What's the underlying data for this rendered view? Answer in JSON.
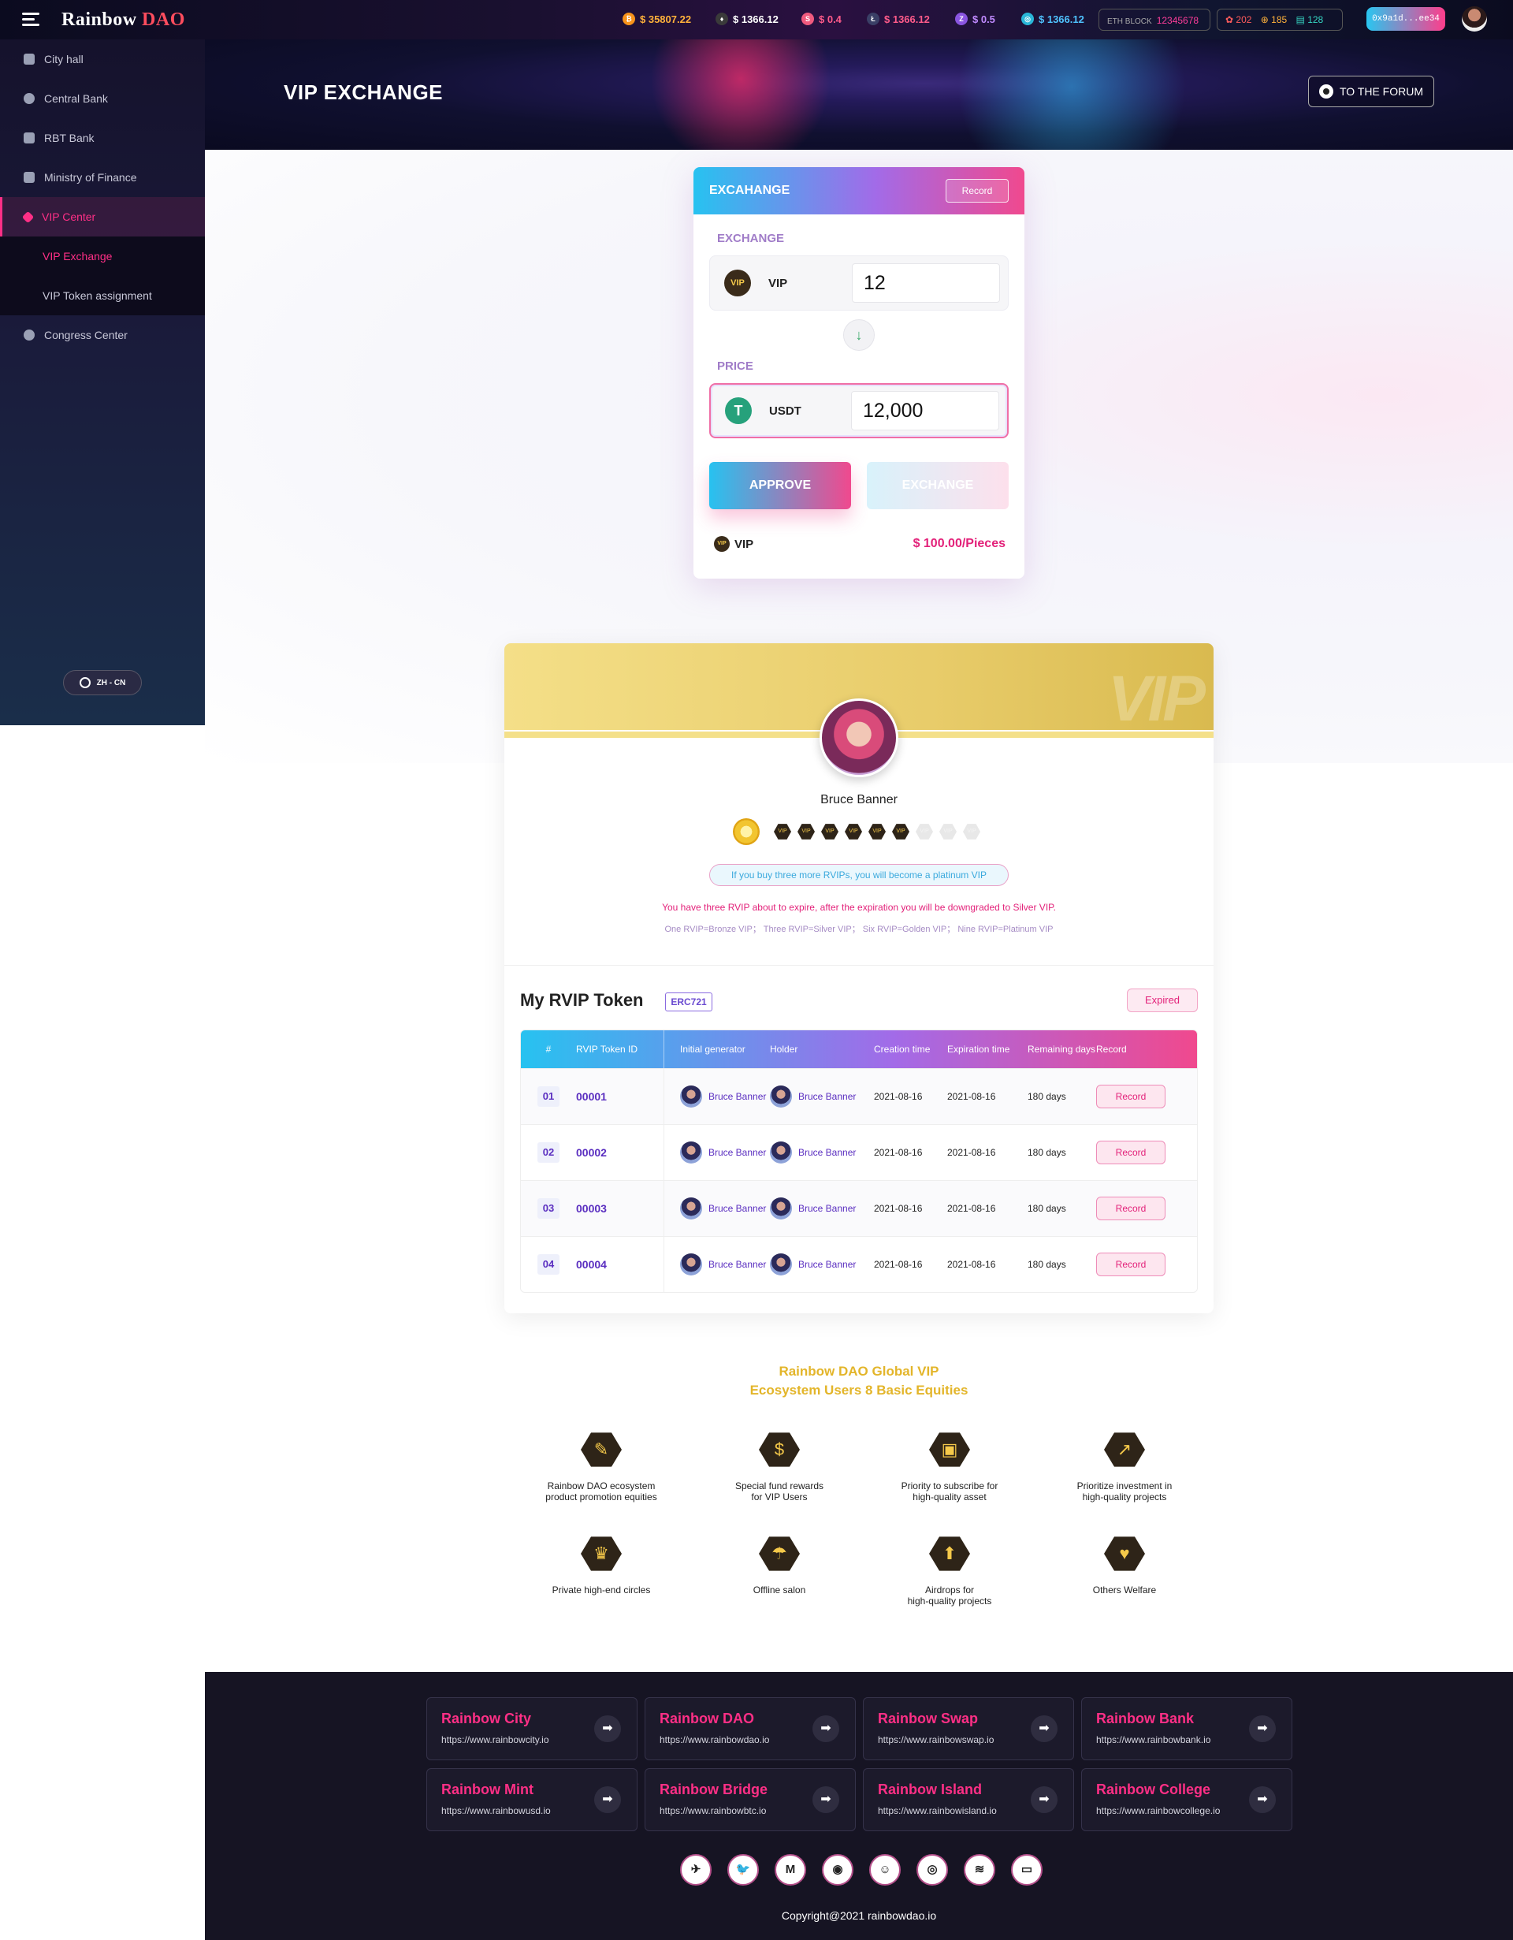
{
  "app": {
    "logo_main": "Rainbow ",
    "logo_accent": "DAO"
  },
  "topbar": {
    "prices": [
      {
        "icon": "bitcoin-icon",
        "symbol": "₿",
        "color": "#f7931a",
        "text_color": "#ffb23b",
        "value": "$ 35807.22"
      },
      {
        "icon": "ethereum-icon",
        "symbol": "♦",
        "color": "#3a3a3a",
        "text_color": "#ffffff",
        "value": "$ 1366.12"
      },
      {
        "icon": "sushi-icon",
        "symbol": "S",
        "color": "#f05a7e",
        "text_color": "#ff5b8a",
        "value": "$ 0.4"
      },
      {
        "icon": "litecoin-icon",
        "symbol": "Ł",
        "color": "#3a3f66",
        "text_color": "#ff5b8a",
        "value": "$ 1366.12"
      },
      {
        "icon": "zcash-icon",
        "symbol": "Z",
        "color": "#8a55e0",
        "text_color": "#c08aff",
        "value": "$ 0.5"
      },
      {
        "icon": "token-icon",
        "symbol": "◎",
        "color": "#2ab6d8",
        "text_color": "#4fc3ff",
        "value": "$ 1366.12"
      }
    ],
    "eth_block_label": "ETH BLOCK",
    "eth_block_value": "12345678",
    "stats": [
      "202",
      "185",
      "128"
    ],
    "wallet": "0x9a1d...ee34"
  },
  "sidebar": {
    "items": [
      {
        "label": "City hall"
      },
      {
        "label": "Central Bank"
      },
      {
        "label": "RBT Bank"
      },
      {
        "label": "Ministry of Finance"
      },
      {
        "label": "VIP Center"
      }
    ],
    "sub_items": [
      {
        "label": "VIP Exchange"
      },
      {
        "label": "VIP Token assignment"
      }
    ],
    "after_items": [
      {
        "label": "Congress Center"
      }
    ],
    "language": "ZH - CN"
  },
  "header": {
    "title": "VIP EXCHANGE",
    "forum_button": "TO THE FORUM"
  },
  "exchange": {
    "title": "EXCAHANGE",
    "record_button": "Record",
    "from_label": "EXCHANGE",
    "from_token": "VIP",
    "from_amount": "12",
    "to_label": "PRICE",
    "to_token": "USDT",
    "to_amount": "12,000",
    "approve_button": "APPROVE",
    "exchange_button": "EXCHANGE",
    "price_token": "VIP",
    "price_value": "$ 100.00/Pieces"
  },
  "vip": {
    "watermark": "VIP",
    "name": "Bruce Banner",
    "medals_owned": 6,
    "medals_total": 9,
    "tip": "If you buy three more RVIPs, you will become a platinum VIP",
    "warning": "You have three RVIP about to expire, after the expiration you will be downgraded to Silver VIP.",
    "levels": "One RVIP=Bronze VIP； Three RVIP=Silver VIP； Six RVIP=Golden VIP； Nine RVIP=Platinum VIP"
  },
  "rvip": {
    "title": "My RVIP Token",
    "standard": "ERC721",
    "expired_button": "Expired",
    "columns": [
      "#",
      "RVIP Token ID",
      "Initial generator",
      "Holder",
      "Creation time",
      "Expiration time",
      "Remaining days",
      "Record"
    ],
    "rows": [
      {
        "num": "01",
        "id": "00001",
        "generator": "Bruce Banner",
        "holder": "Bruce Banner",
        "created": "2021-08-16",
        "expires": "2021-08-16",
        "remaining": "180 days",
        "record": "Record"
      },
      {
        "num": "02",
        "id": "00002",
        "generator": "Bruce Banner",
        "holder": "Bruce Banner",
        "created": "2021-08-16",
        "expires": "2021-08-16",
        "remaining": "180 days",
        "record": "Record"
      },
      {
        "num": "03",
        "id": "00003",
        "generator": "Bruce Banner",
        "holder": "Bruce Banner",
        "created": "2021-08-16",
        "expires": "2021-08-16",
        "remaining": "180 days",
        "record": "Record"
      },
      {
        "num": "04",
        "id": "00004",
        "generator": "Bruce Banner",
        "holder": "Bruce Banner",
        "created": "2021-08-16",
        "expires": "2021-08-16",
        "remaining": "180 days",
        "record": "Record"
      }
    ]
  },
  "equities": {
    "title_line1": "Rainbow DAO Global VIP",
    "title_line2": "Ecosystem Users 8 Basic Equities",
    "items": [
      {
        "icon": "promotion-icon",
        "glyph": "✎",
        "line1": "Rainbow DAO ecosystem",
        "line2": "product promotion equities"
      },
      {
        "icon": "fund-rewards-icon",
        "glyph": "$",
        "line1": "Special fund rewards",
        "line2": "for VIP Users"
      },
      {
        "icon": "subscribe-icon",
        "glyph": "▣",
        "line1": "Priority to subscribe for",
        "line2": "high-quality asset"
      },
      {
        "icon": "investment-icon",
        "glyph": "↗",
        "line1": "Prioritize investment in",
        "line2": "high-quality projects"
      },
      {
        "icon": "crown-icon",
        "glyph": "♛",
        "line1": "Private high-end circles",
        "line2": ""
      },
      {
        "icon": "salon-icon",
        "glyph": "☂",
        "line1": "Offline salon",
        "line2": ""
      },
      {
        "icon": "airdrop-icon",
        "glyph": "⬆",
        "line1": "Airdrops for",
        "line2": "high-quality projects"
      },
      {
        "icon": "welfare-icon",
        "glyph": "♥",
        "line1": "Others Welfare",
        "line2": ""
      }
    ]
  },
  "footer": {
    "links": [
      {
        "name": "Rainbow City",
        "url": "https://www.rainbowcity.io"
      },
      {
        "name": "Rainbow DAO",
        "url": "https://www.rainbowdao.io"
      },
      {
        "name": "Rainbow Swap",
        "url": "https://www.rainbowswap.io"
      },
      {
        "name": "Rainbow Bank",
        "url": "https://www.rainbowbank.io"
      },
      {
        "name": "Rainbow Mint",
        "url": "https://www.rainbowusd.io"
      },
      {
        "name": "Rainbow Bridge",
        "url": "https://www.rainbowbtc.io"
      },
      {
        "name": "Rainbow Island",
        "url": "https://www.rainbowisland.io"
      },
      {
        "name": "Rainbow College",
        "url": "https://www.rainbowcollege.io"
      }
    ],
    "social": [
      {
        "icon": "telegram-icon",
        "glyph": "✈"
      },
      {
        "icon": "twitter-icon",
        "glyph": "🐦"
      },
      {
        "icon": "medium-icon",
        "glyph": "M"
      },
      {
        "icon": "reddit-icon",
        "glyph": "◉"
      },
      {
        "icon": "discord-icon",
        "glyph": "☺"
      },
      {
        "icon": "github-icon",
        "glyph": "◎"
      },
      {
        "icon": "layers-icon",
        "glyph": "≋"
      },
      {
        "icon": "chat-icon",
        "glyph": "▭"
      }
    ],
    "copyright": "Copyright@2021 rainbowdao.io"
  }
}
